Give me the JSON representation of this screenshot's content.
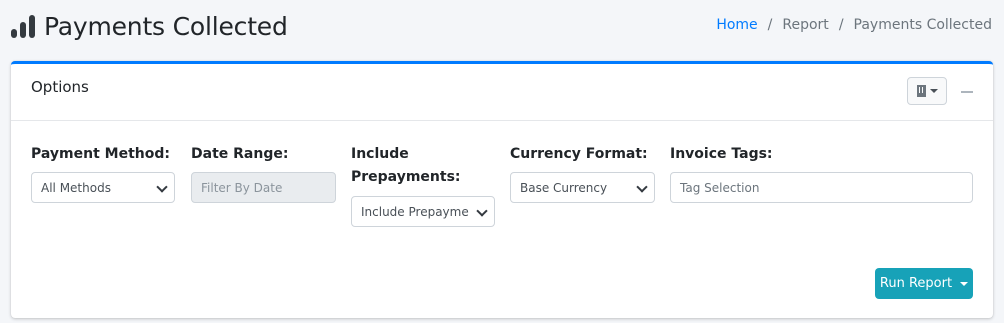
{
  "header": {
    "icon": "chart-bars-icon",
    "title": "Payments Collected",
    "breadcrumb": {
      "home": "Home",
      "report": "Report",
      "current": "Payments Collected",
      "separator": "/"
    }
  },
  "card": {
    "title": "Options",
    "accent_color": "#007bff",
    "tools": {
      "company_icon": "building-icon",
      "collapse_icon": "minus-icon"
    }
  },
  "fields": {
    "payment_method": {
      "label": "Payment Method:",
      "value": "All Methods"
    },
    "date_range": {
      "label": "Date Range:",
      "placeholder": "Filter By Date"
    },
    "include_prepayments": {
      "label_line1": "Include",
      "label_line2": "Prepayments:",
      "value": "Include Prepayme"
    },
    "currency_format": {
      "label": "Currency Format:",
      "value": "Base Currency"
    },
    "invoice_tags": {
      "label": "Invoice Tags:",
      "placeholder": "Tag Selection"
    }
  },
  "actions": {
    "run_report": "Run Report",
    "run_report_color": "#17a2b8"
  }
}
